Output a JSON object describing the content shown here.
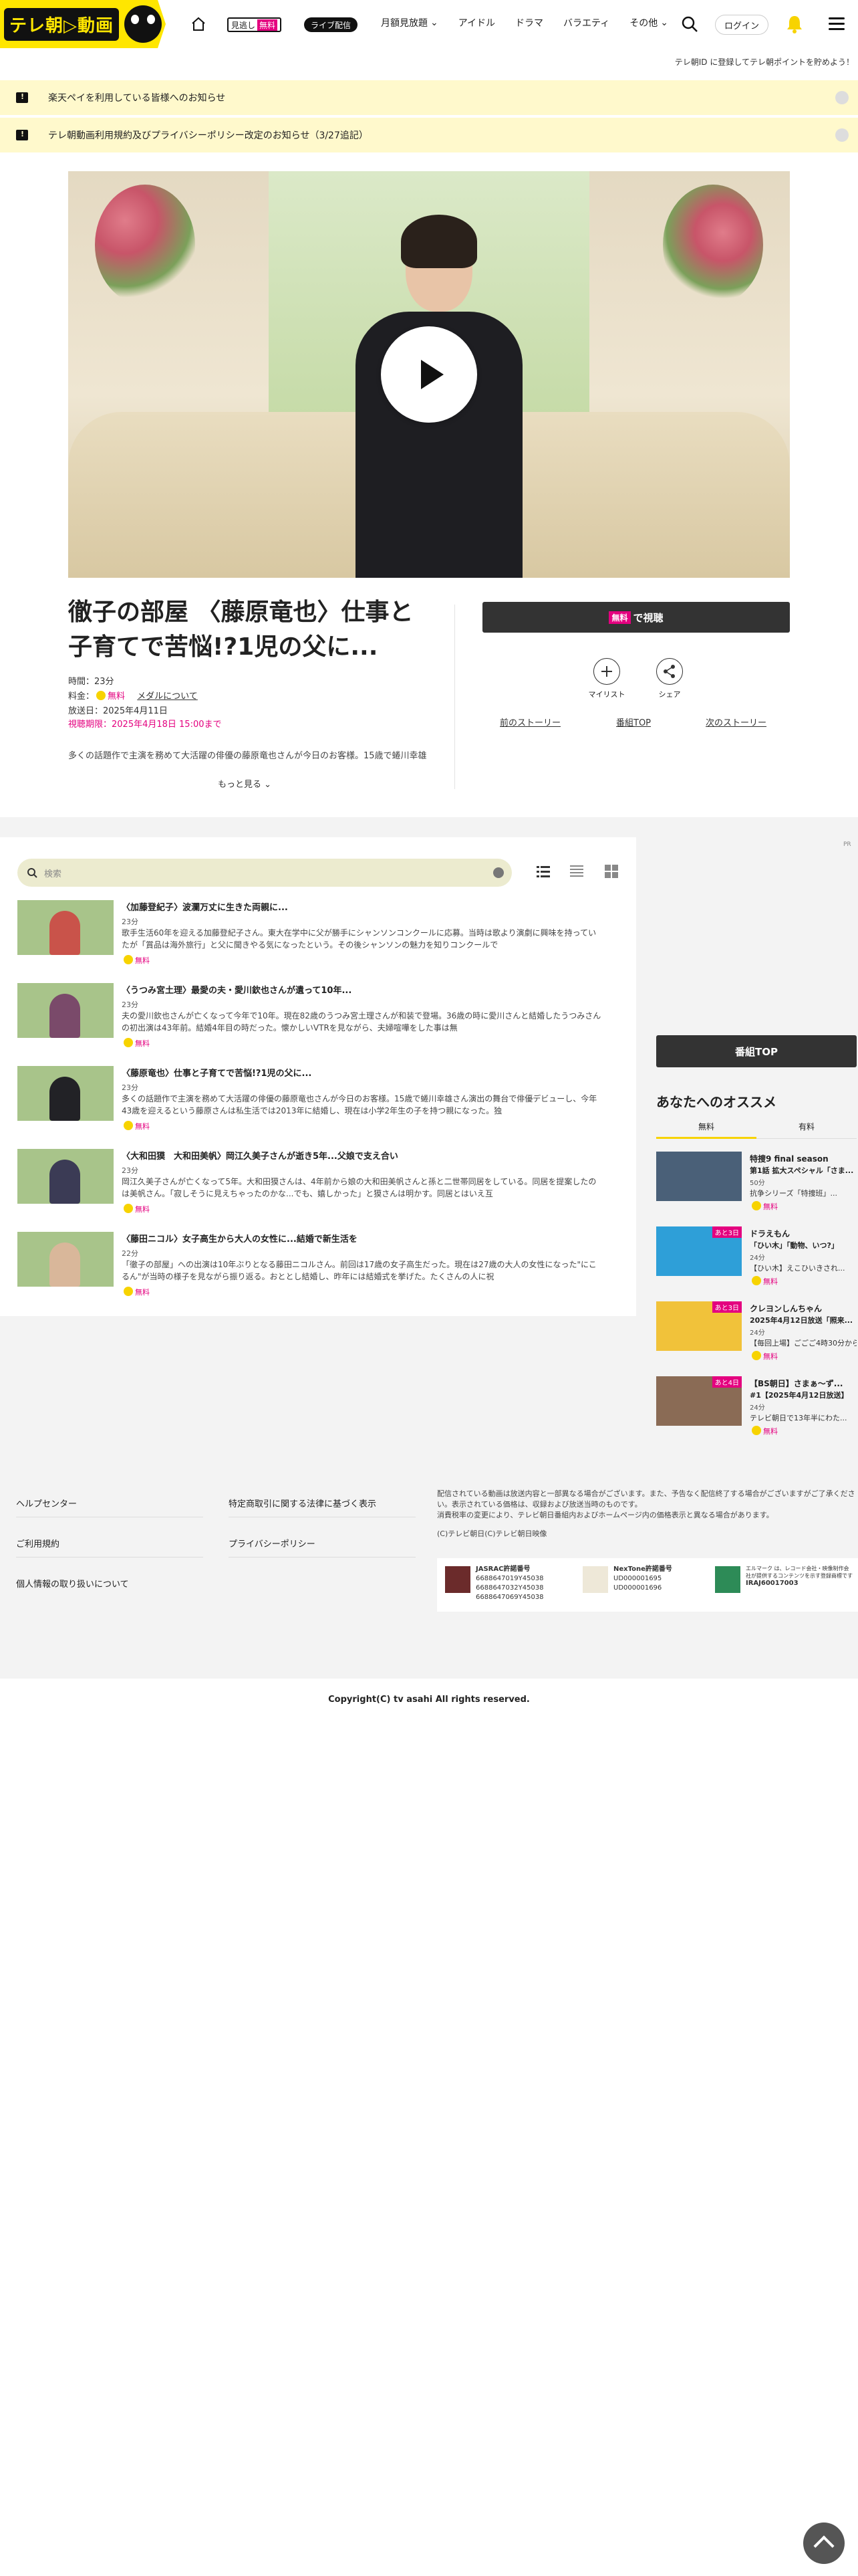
{
  "header": {
    "logo_text": "テレ朝▷動画",
    "free_pill": "見逃し",
    "free_badge": "無料",
    "live_pill": "ライブ配信",
    "nav": [
      "月額見放題",
      "アイドル",
      "ドラマ",
      "バラエティ",
      "その他"
    ],
    "login": "ログイン"
  },
  "promo_text": "テレ朝ID に登録してテレ朝ポイントを貯めよう！",
  "notices": [
    "楽天ペイを利用している皆様へのお知らせ",
    "テレ朝動画利用規約及びプライバシーポリシー改定のお知らせ（3/27追記）"
  ],
  "episode": {
    "title": "徹子の部屋 〈藤原竜也〉仕事と子育てで苦悩!?1児の父に...",
    "duration": "時間：23分",
    "price_label": "料金：",
    "price_value": "無料",
    "medal_link": "メダルについて",
    "aired": "放送日：2025年4月11日",
    "expires": "視聴期限：2025年4月18日 15:00まで",
    "description": "多くの話題作で主演を務めて大活躍の俳優の藤原竜也さんが今日のお客様。15歳で蜷川幸雄",
    "more": "もっと見る"
  },
  "actions": {
    "watch_badge": "無料",
    "watch_label": "で視聴",
    "mylist": "マイリスト",
    "share": "シェア",
    "prev": "前のストーリー",
    "top": "番組TOP",
    "next": "次のストーリー"
  },
  "search": {
    "placeholder": "検索"
  },
  "episodes": [
    {
      "title": "〈加藤登紀子〉波瀾万丈に生きた両親に...",
      "duration": "23分",
      "desc": "歌手生活60年を迎える加藤登紀子さん。東大在学中に父が勝手にシャンソンコンクールに応募。当時は歌より演劇に興味を持っていたが「賞品は海外旅行」と父に聞きやる気になったという。その後シャンソンの魅力を知りコンクールで",
      "price": "無料",
      "color": "#c9534a"
    },
    {
      "title": "〈うつみ宮土理〉最愛の夫・愛川欽也さんが遺って10年...",
      "duration": "23分",
      "desc": "夫の愛川欽也さんが亡くなって今年で10年。現在82歳のうつみ宮土理さんが和装で登場。36歳の時に愛川さんと結婚したうつみさんの初出演は43年前。結婚4年目の時だった。懐かしいVTRを見ながら、夫婦喧嘩をした事は無",
      "price": "無料",
      "color": "#7a4a6a"
    },
    {
      "title": "〈藤原竜也〉仕事と子育てで苦悩!?1児の父に...",
      "duration": "23分",
      "desc": "多くの話題作で主演を務めて大活躍の俳優の藤原竜也さんが今日のお客様。15歳で蜷川幸雄さん演出の舞台で俳優デビューし、今年43歳を迎えるという藤原さんは私生活では2013年に結婚し、現在は小学2年生の子を持つ親になった。独",
      "price": "無料",
      "color": "#222226"
    },
    {
      "title": "〈大和田獏　大和田美帆〉岡江久美子さんが逝き5年...父娘で支え合い",
      "duration": "23分",
      "desc": "岡江久美子さんが亡くなって5年。大和田獏さんは、4年前から娘の大和田美帆さんと孫と二世帯同居をしている。同居を提案したのは美帆さん。「寂しそうに見えちゃったのかな...でも、嬉しかった」と獏さんは明かす。同居とはいえ互",
      "price": "無料",
      "color": "#3b3b55"
    },
    {
      "title": "〈藤田ニコル〉女子高生から大人の女性に...結婚で新生活を",
      "duration": "22分",
      "desc": "「徹子の部屋」への出演は10年ぶりとなる藤田ニコルさん。前回は17歳の女子高生だった。現在は27歳の大人の女性になった\"にこるん\"が当時の様子を見ながら振り返る。おととし結婚し、昨年には結婚式を挙げた。たくさんの人に祝",
      "price": "無料",
      "color": "#d9b79a"
    }
  ],
  "sidebar": {
    "bangumi_top": "番組TOP",
    "rec_title": "あなたへのオススメ",
    "tabs": [
      "無料",
      "有料"
    ],
    "items": [
      {
        "l1": "特捜9 final season",
        "l2": "第1話 拡大スペシャル「さま...",
        "l3": "50分",
        "l4": "抗争シリーズ「特捜班」...",
        "price": "無料",
        "badge": "",
        "color": "#4a6078"
      },
      {
        "l1": "ドラえもん",
        "l2": "「ひい木」「動物、いつ?」",
        "l3": "24分",
        "l4": "【ひい木】えこひいきされ...",
        "price": "無料",
        "badge": "あと3日",
        "color": "#2e9fd8"
      },
      {
        "l1": "クレヨンしんちゃん",
        "l2": "2025年4月12日放送「照来...",
        "l3": "24分",
        "l4": "【毎回上場】ごごご4時30分から...",
        "price": "無料",
        "badge": "あと3日",
        "color": "#f1c23a"
      },
      {
        "l1": "【BS朝日】さまぁ～ず...",
        "l2": "#1【2025年4月12日放送】",
        "l3": "24分",
        "l4": "テレビ朝日で13年半にわた...",
        "price": "無料",
        "badge": "あと4日",
        "color": "#8a6b55"
      }
    ]
  },
  "footer": {
    "links_left": [
      "ヘルプセンター",
      "ご利用規約",
      "個人情報の取り扱いについて"
    ],
    "links_right": [
      "特定商取引に関する法律に基づく表示",
      "プライバシーポリシー"
    ],
    "note1": "配信されている動画は放送内容と一部異なる場合がございます。また、予告なく配信終了する場合がございますがご了承ください。表示されている価格は、収録および放送当時のものです。",
    "note2": "消費税率の変更により、テレビ朝日番組内およびホームページ内の価格表示と異なる場合があります。",
    "note3": "(C)テレビ朝日(C)テレビ朝日映像",
    "jasrac_title": "JASRAC許諾番号",
    "jasrac_nums": "6688647019Y45038 6688647032Y45038 6688647069Y45038",
    "nextone_title": "NexTone許諾番号",
    "nextone_nums": "UD000001695 UD000001696",
    "ll_text": "エルマーク は、レコード会社・映像制作会社が提供するコンテンツを示す登録商標です",
    "ll_num": "IRAJ60017003"
  },
  "copyright": "Copyright(C) tv asahi All rights reserved."
}
